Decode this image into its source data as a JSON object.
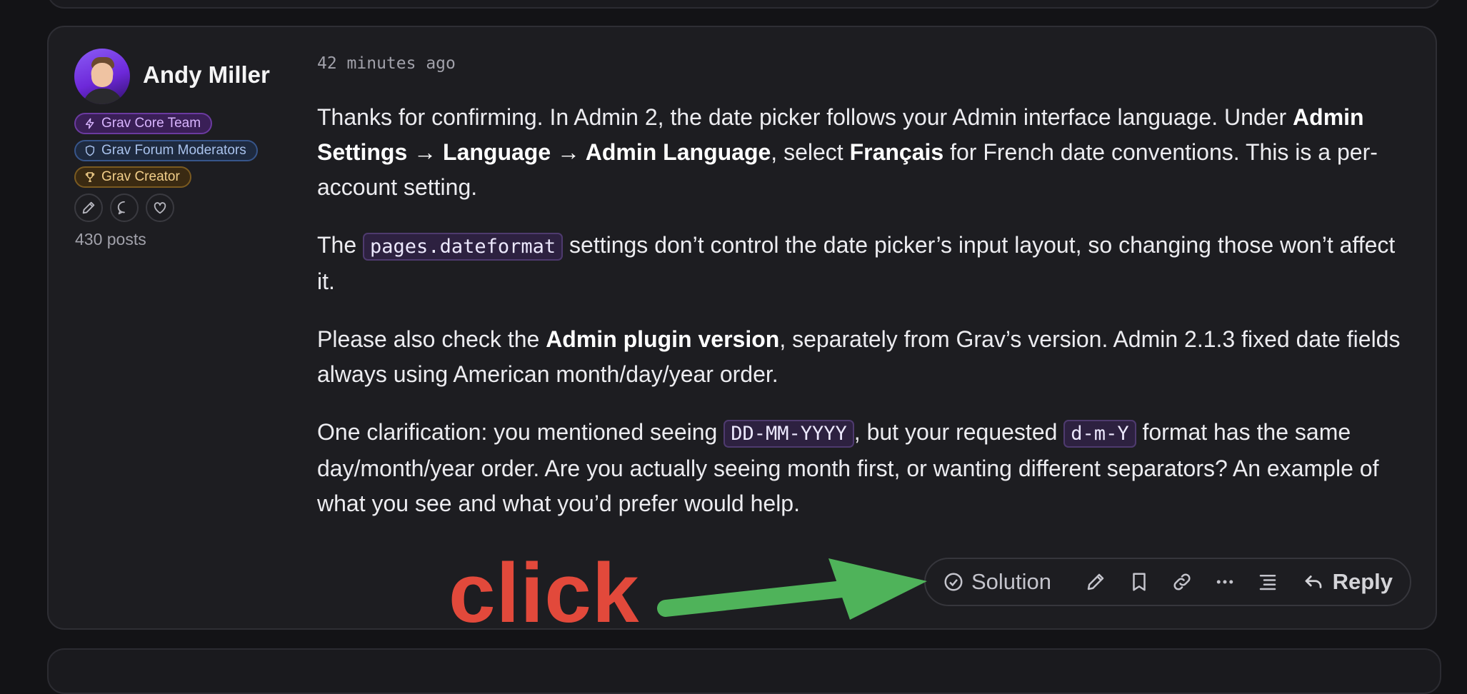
{
  "post": {
    "author": {
      "name": "Andy Miller",
      "badges": [
        "Grav Core Team",
        "Grav Forum Moderators",
        "Grav Creator"
      ],
      "posts": "430 posts"
    },
    "timestamp": "42 minutes ago",
    "paragraphs": {
      "p1_a": "Thanks for confirming. In Admin 2, the date picker follows your Admin interface language. Under ",
      "p1_b": "Admin Settings → Language → Admin Language",
      "p1_c": ", select ",
      "p1_d": "Français",
      "p1_e": " for French date conventions. This is a per-account setting.",
      "p2_a": "The ",
      "p2_code": "pages.dateformat",
      "p2_b": " settings don’t control the date picker’s input layout, so changing those won’t affect it.",
      "p3_a": "Please also check the ",
      "p3_b": "Admin plugin version",
      "p3_c": ", separately from Grav’s version. Admin 2.1.3 fixed date fields always using American month/day/year order.",
      "p4_a": "One clarification: you mentioned seeing ",
      "p4_code1": "DD-MM-YYYY",
      "p4_b": ", but your requested ",
      "p4_code2": "d-m-Y",
      "p4_c": " format has the same day/month/year order. Are you actually seeing month first, or wanting different separators? An example of what you see and what you’d prefer would help."
    },
    "toolbar": {
      "solution_label": "Solution",
      "reply_label": "Reply"
    }
  },
  "annotation": {
    "text": "click",
    "color": "#e2493b",
    "arrow_color": "#4fb35a"
  },
  "icons": [
    "pencil-icon",
    "chat-bubble-icon",
    "heart-icon",
    "check-circle-icon",
    "bookmark-icon",
    "link-icon",
    "more-icon",
    "thread-icon",
    "reply-arrow-icon",
    "bolt-icon",
    "shield-icon",
    "trophy-icon"
  ]
}
